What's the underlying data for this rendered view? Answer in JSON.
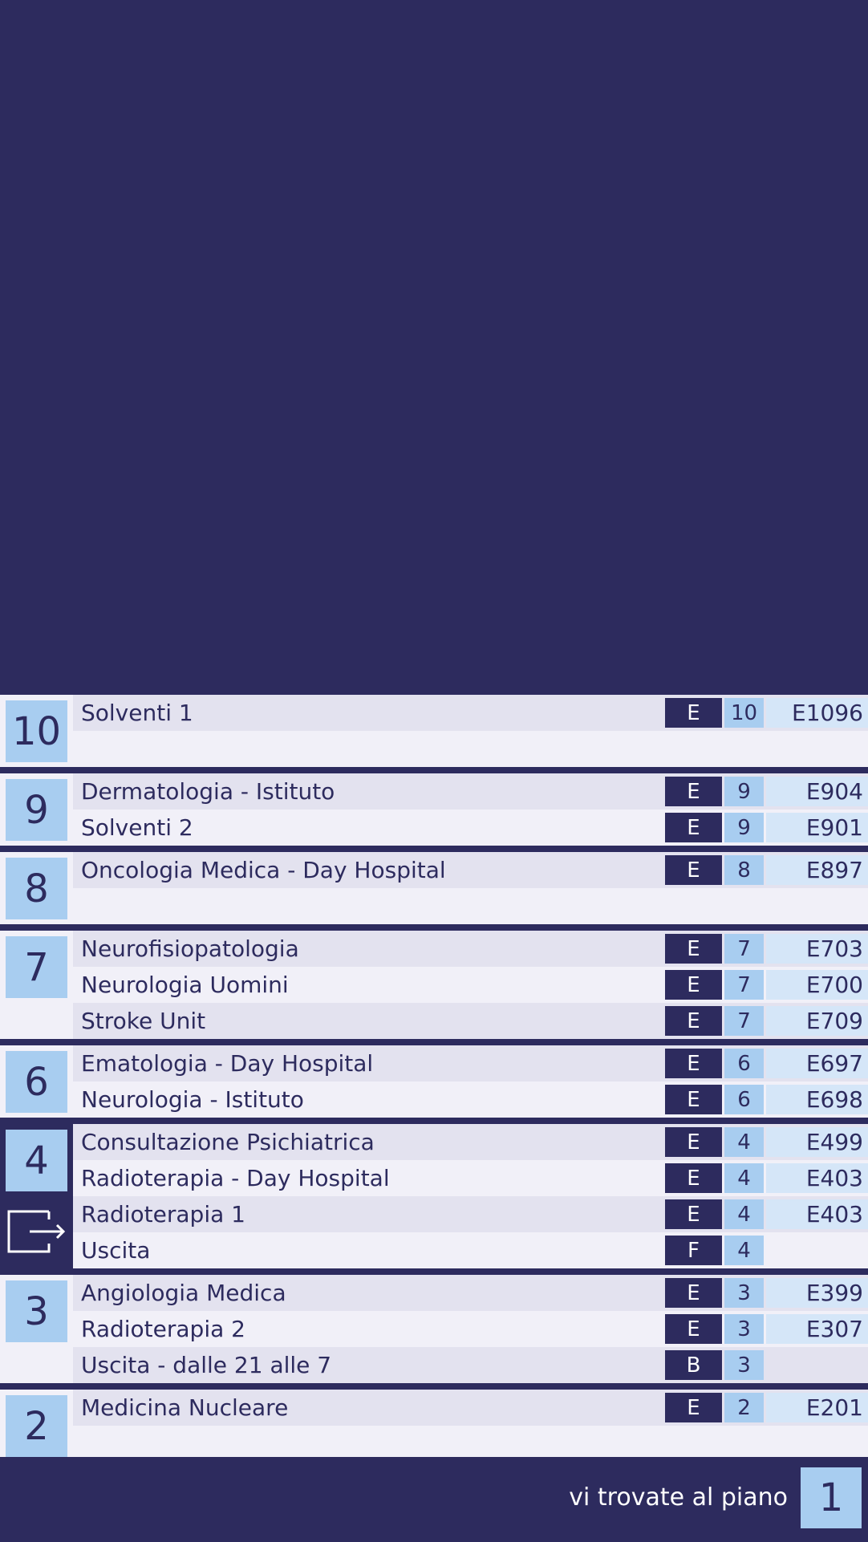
{
  "floors": [
    {
      "number": "10",
      "rows": [
        {
          "name": "Solventi 1",
          "building": "E",
          "floor": "10",
          "room": "E1096"
        }
      ]
    },
    {
      "number": "9",
      "rows": [
        {
          "name": "Dermatologia - Istituto",
          "building": "E",
          "floor": "9",
          "room": "E904"
        },
        {
          "name": "Solventi 2",
          "building": "E",
          "floor": "9",
          "room": "E901"
        }
      ]
    },
    {
      "number": "8",
      "rows": [
        {
          "name": "Oncologia Medica - Day Hospital",
          "building": "E",
          "floor": "8",
          "room": "E897"
        }
      ]
    },
    {
      "number": "7",
      "rows": [
        {
          "name": "Neurofisiopatologia",
          "building": "E",
          "floor": "7",
          "room": "E703"
        },
        {
          "name": "Neurologia Uomini",
          "building": "E",
          "floor": "7",
          "room": "E700"
        },
        {
          "name": "Stroke Unit",
          "building": "E",
          "floor": "7",
          "room": "E709"
        }
      ]
    },
    {
      "number": "6",
      "rows": [
        {
          "name": "Ematologia - Day Hospital",
          "building": "E",
          "floor": "6",
          "room": "E697"
        },
        {
          "name": "Neurologia - Istituto",
          "building": "E",
          "floor": "6",
          "room": "E698"
        }
      ]
    },
    {
      "number": "4",
      "current": true,
      "rows": [
        {
          "name": "Consultazione Psichiatrica",
          "building": "E",
          "floor": "4",
          "room": "E499"
        },
        {
          "name": "Radioterapia - Day Hospital",
          "building": "E",
          "floor": "4",
          "room": "E403"
        },
        {
          "name": "Radioterapia 1",
          "building": "E",
          "floor": "4",
          "room": "E403"
        },
        {
          "name": "Uscita",
          "building": "F",
          "floor": "4",
          "room": ""
        }
      ]
    },
    {
      "number": "3",
      "rows": [
        {
          "name": "Angiologia Medica",
          "building": "E",
          "floor": "3",
          "room": "E399"
        },
        {
          "name": "Radioterapia 2",
          "building": "E",
          "floor": "3",
          "room": "E307"
        },
        {
          "name": "Uscita - dalle 21 alle 7",
          "building": "B",
          "floor": "3",
          "room": ""
        }
      ]
    },
    {
      "number": "2",
      "rows": [
        {
          "name": "Medicina Nucleare",
          "building": "E",
          "floor": "2",
          "room": "E201"
        }
      ]
    }
  ],
  "footer": {
    "label": "vi trovate al piano",
    "current_floor": "1"
  },
  "colors": {
    "navy": "#2d2b5e",
    "light_blue": "#a8cdf0",
    "row_light": "#f1f0f8",
    "row_alt": "#e3e2ef",
    "room_bg": "#d5e6f8"
  }
}
